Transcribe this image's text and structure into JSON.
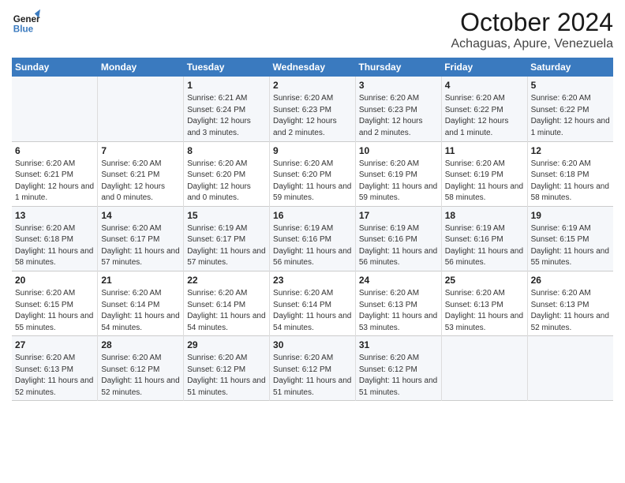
{
  "header": {
    "logo_general": "General",
    "logo_blue": "Blue",
    "month_title": "October 2024",
    "subtitle": "Achaguas, Apure, Venezuela"
  },
  "days_of_week": [
    "Sunday",
    "Monday",
    "Tuesday",
    "Wednesday",
    "Thursday",
    "Friday",
    "Saturday"
  ],
  "weeks": [
    [
      {
        "day": "",
        "text": ""
      },
      {
        "day": "",
        "text": ""
      },
      {
        "day": "1",
        "text": "Sunrise: 6:21 AM\nSunset: 6:24 PM\nDaylight: 12 hours and 3 minutes."
      },
      {
        "day": "2",
        "text": "Sunrise: 6:20 AM\nSunset: 6:23 PM\nDaylight: 12 hours and 2 minutes."
      },
      {
        "day": "3",
        "text": "Sunrise: 6:20 AM\nSunset: 6:23 PM\nDaylight: 12 hours and 2 minutes."
      },
      {
        "day": "4",
        "text": "Sunrise: 6:20 AM\nSunset: 6:22 PM\nDaylight: 12 hours and 1 minute."
      },
      {
        "day": "5",
        "text": "Sunrise: 6:20 AM\nSunset: 6:22 PM\nDaylight: 12 hours and 1 minute."
      }
    ],
    [
      {
        "day": "6",
        "text": "Sunrise: 6:20 AM\nSunset: 6:21 PM\nDaylight: 12 hours and 1 minute."
      },
      {
        "day": "7",
        "text": "Sunrise: 6:20 AM\nSunset: 6:21 PM\nDaylight: 12 hours and 0 minutes."
      },
      {
        "day": "8",
        "text": "Sunrise: 6:20 AM\nSunset: 6:20 PM\nDaylight: 12 hours and 0 minutes."
      },
      {
        "day": "9",
        "text": "Sunrise: 6:20 AM\nSunset: 6:20 PM\nDaylight: 11 hours and 59 minutes."
      },
      {
        "day": "10",
        "text": "Sunrise: 6:20 AM\nSunset: 6:19 PM\nDaylight: 11 hours and 59 minutes."
      },
      {
        "day": "11",
        "text": "Sunrise: 6:20 AM\nSunset: 6:19 PM\nDaylight: 11 hours and 58 minutes."
      },
      {
        "day": "12",
        "text": "Sunrise: 6:20 AM\nSunset: 6:18 PM\nDaylight: 11 hours and 58 minutes."
      }
    ],
    [
      {
        "day": "13",
        "text": "Sunrise: 6:20 AM\nSunset: 6:18 PM\nDaylight: 11 hours and 58 minutes."
      },
      {
        "day": "14",
        "text": "Sunrise: 6:20 AM\nSunset: 6:17 PM\nDaylight: 11 hours and 57 minutes."
      },
      {
        "day": "15",
        "text": "Sunrise: 6:19 AM\nSunset: 6:17 PM\nDaylight: 11 hours and 57 minutes."
      },
      {
        "day": "16",
        "text": "Sunrise: 6:19 AM\nSunset: 6:16 PM\nDaylight: 11 hours and 56 minutes."
      },
      {
        "day": "17",
        "text": "Sunrise: 6:19 AM\nSunset: 6:16 PM\nDaylight: 11 hours and 56 minutes."
      },
      {
        "day": "18",
        "text": "Sunrise: 6:19 AM\nSunset: 6:16 PM\nDaylight: 11 hours and 56 minutes."
      },
      {
        "day": "19",
        "text": "Sunrise: 6:19 AM\nSunset: 6:15 PM\nDaylight: 11 hours and 55 minutes."
      }
    ],
    [
      {
        "day": "20",
        "text": "Sunrise: 6:20 AM\nSunset: 6:15 PM\nDaylight: 11 hours and 55 minutes."
      },
      {
        "day": "21",
        "text": "Sunrise: 6:20 AM\nSunset: 6:14 PM\nDaylight: 11 hours and 54 minutes."
      },
      {
        "day": "22",
        "text": "Sunrise: 6:20 AM\nSunset: 6:14 PM\nDaylight: 11 hours and 54 minutes."
      },
      {
        "day": "23",
        "text": "Sunrise: 6:20 AM\nSunset: 6:14 PM\nDaylight: 11 hours and 54 minutes."
      },
      {
        "day": "24",
        "text": "Sunrise: 6:20 AM\nSunset: 6:13 PM\nDaylight: 11 hours and 53 minutes."
      },
      {
        "day": "25",
        "text": "Sunrise: 6:20 AM\nSunset: 6:13 PM\nDaylight: 11 hours and 53 minutes."
      },
      {
        "day": "26",
        "text": "Sunrise: 6:20 AM\nSunset: 6:13 PM\nDaylight: 11 hours and 52 minutes."
      }
    ],
    [
      {
        "day": "27",
        "text": "Sunrise: 6:20 AM\nSunset: 6:13 PM\nDaylight: 11 hours and 52 minutes."
      },
      {
        "day": "28",
        "text": "Sunrise: 6:20 AM\nSunset: 6:12 PM\nDaylight: 11 hours and 52 minutes."
      },
      {
        "day": "29",
        "text": "Sunrise: 6:20 AM\nSunset: 6:12 PM\nDaylight: 11 hours and 51 minutes."
      },
      {
        "day": "30",
        "text": "Sunrise: 6:20 AM\nSunset: 6:12 PM\nDaylight: 11 hours and 51 minutes."
      },
      {
        "day": "31",
        "text": "Sunrise: 6:20 AM\nSunset: 6:12 PM\nDaylight: 11 hours and 51 minutes."
      },
      {
        "day": "",
        "text": ""
      },
      {
        "day": "",
        "text": ""
      }
    ]
  ]
}
